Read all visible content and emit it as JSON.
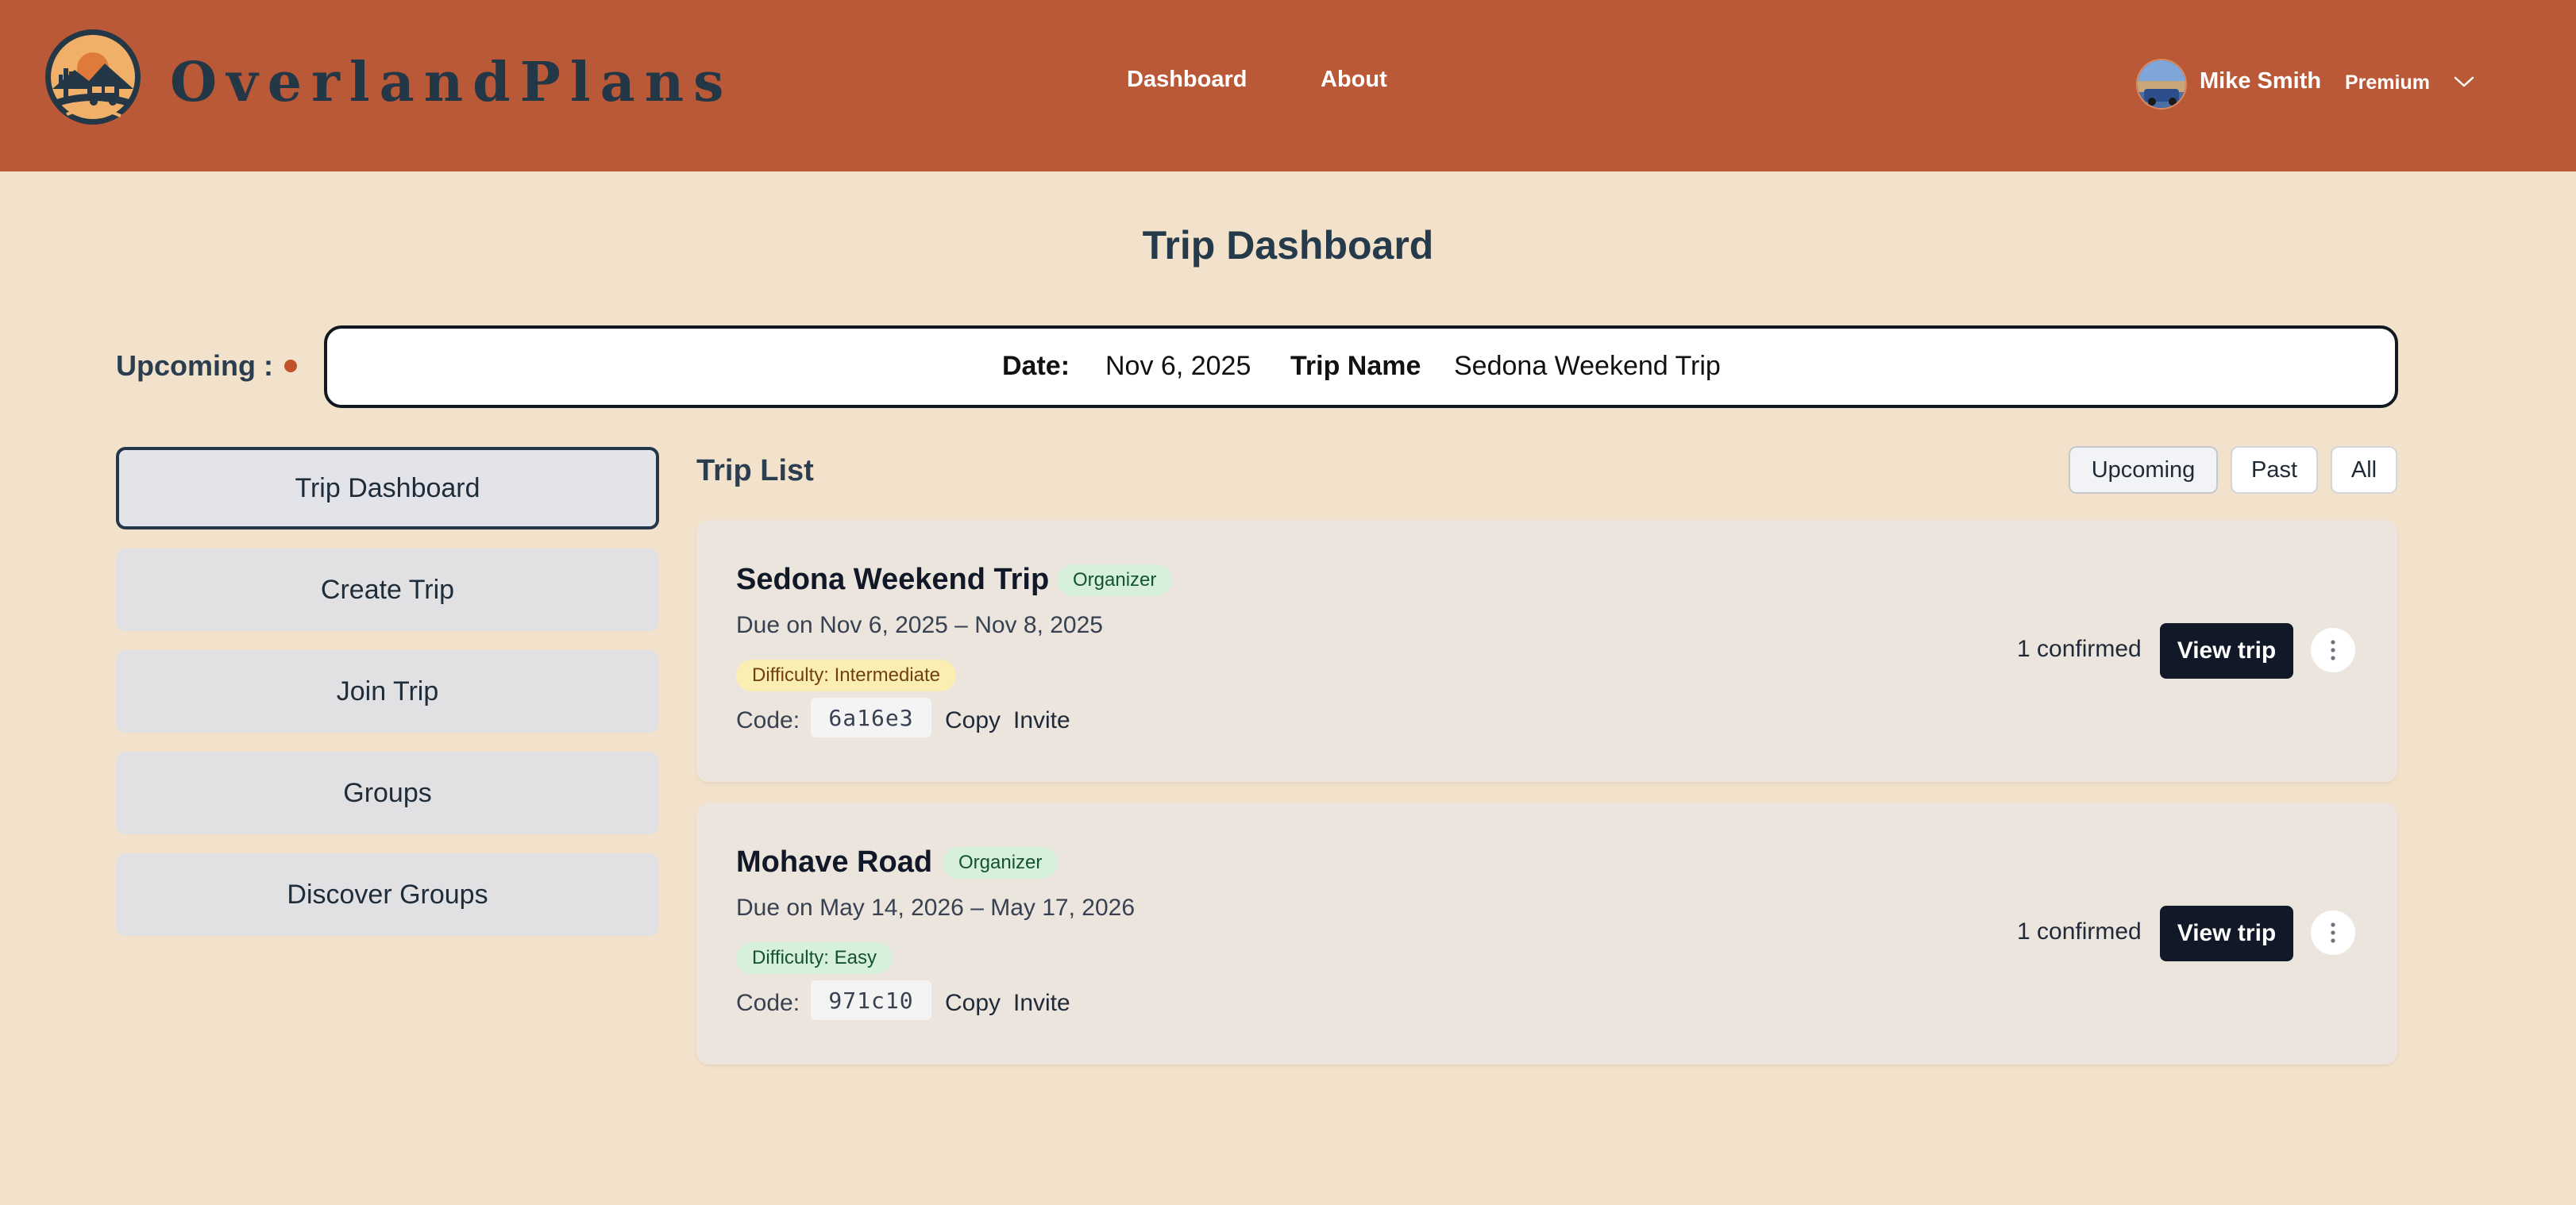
{
  "header": {
    "brand": "OverlandPlans",
    "nav": {
      "dashboard": "Dashboard",
      "about": "About"
    },
    "user": {
      "name": "Mike Smith",
      "plan": "Premium"
    },
    "colors": {
      "header_bg": "#ba5937",
      "brand_text": "#243746"
    }
  },
  "page": {
    "title": "Trip Dashboard",
    "bg_color": "#f2e2cb"
  },
  "upcoming": {
    "label": "Upcoming :",
    "date_label": "Date:",
    "date": "Nov 6, 2025",
    "trip_name_label": "Trip Name",
    "trip_name": "Sedona Weekend Trip"
  },
  "sidebar": {
    "items": [
      {
        "label": "Trip Dashboard",
        "active": true
      },
      {
        "label": "Create Trip"
      },
      {
        "label": "Join Trip"
      },
      {
        "label": "Groups"
      },
      {
        "label": "Discover Groups"
      }
    ]
  },
  "trip_list": {
    "title": "Trip List",
    "filters": [
      "Upcoming",
      "Past",
      "All"
    ],
    "active_filter": "Upcoming",
    "trips": [
      {
        "name": "Sedona Weekend Trip",
        "role": "Organizer",
        "dates": "Due on Nov 6, 2025 – Nov 8, 2025",
        "difficulty": "Difficulty: Intermediate",
        "code_label": "Code:",
        "code": "6a16e3",
        "copy": "Copy",
        "invite": "Invite",
        "confirmed": "1 confirmed",
        "view": "View trip"
      },
      {
        "name": "Mohave Road",
        "role": "Organizer",
        "dates": "Due on May 14, 2026 – May 17, 2026",
        "difficulty": "Difficulty: Easy",
        "code_label": "Code:",
        "code": "971c10",
        "copy": "Copy",
        "invite": "Invite",
        "confirmed": "1 confirmed",
        "view": "View trip"
      }
    ]
  },
  "icons": {
    "logo": "overland-logo-icon",
    "avatar": "user-avatar",
    "chevron": "chevron-down-icon",
    "more": "more-vertical-icon",
    "status_dot": "status-dot"
  }
}
